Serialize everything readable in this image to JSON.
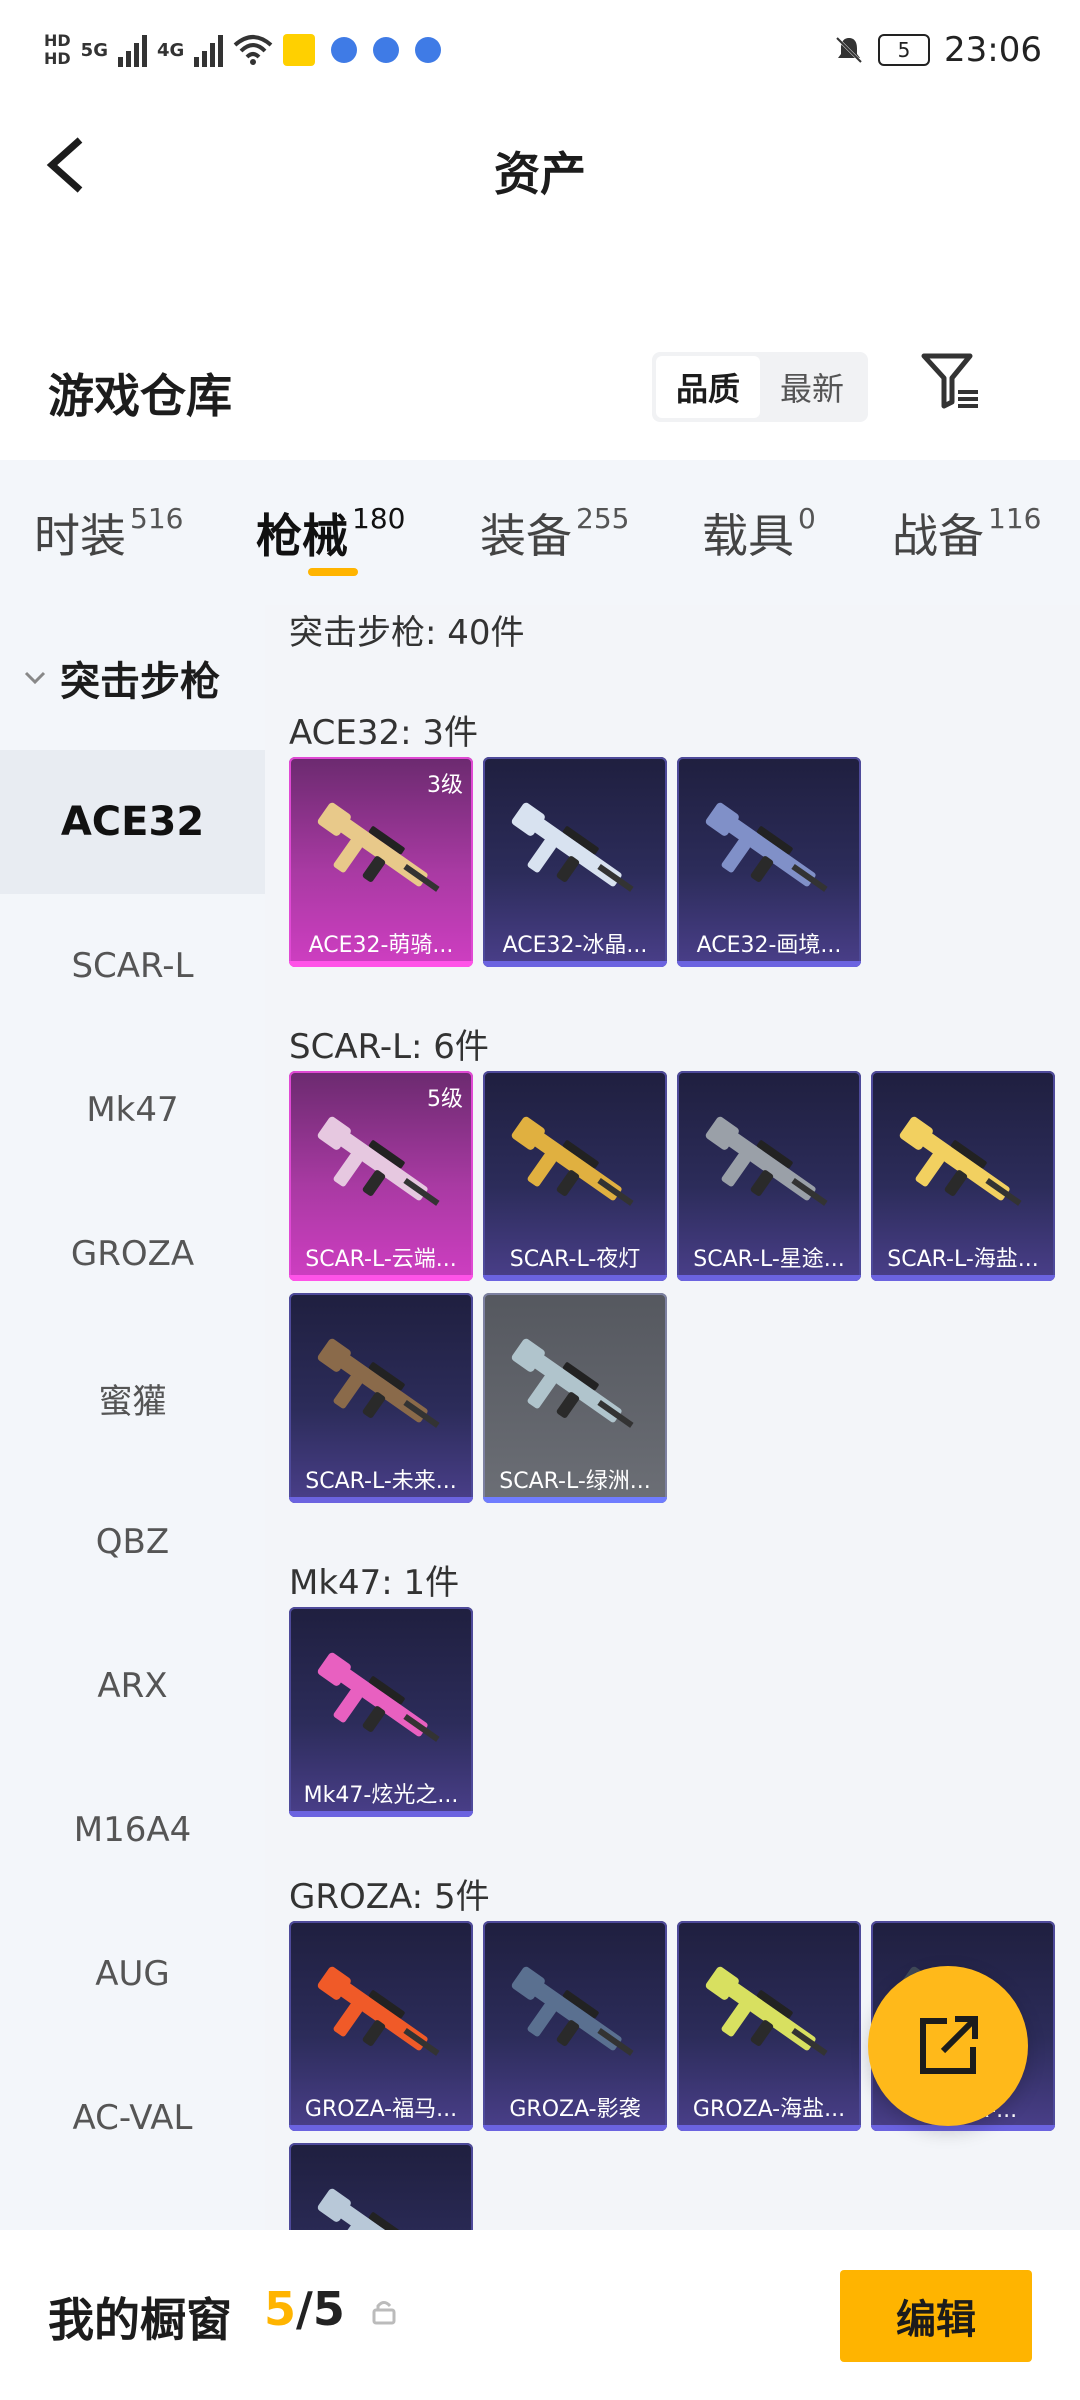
{
  "status_bar": {
    "left_labels": [
      "HD",
      "5G",
      "4G"
    ],
    "time": "23:06",
    "battery": "5"
  },
  "header": {
    "title": "资产"
  },
  "warehouse": {
    "title": "游戏仓库",
    "sort_options": [
      "品质",
      "最新"
    ],
    "active_sort": "品质"
  },
  "tabs": [
    {
      "label": "时装",
      "count": "516"
    },
    {
      "label": "枪械",
      "count": "180"
    },
    {
      "label": "装备",
      "count": "255"
    },
    {
      "label": "载具",
      "count": "0"
    },
    {
      "label": "战备",
      "count": "116"
    }
  ],
  "sidebar": {
    "header": "突击步枪",
    "items": [
      "ACE32",
      "SCAR-L",
      "Mk47",
      "GROZA",
      "蜜獾",
      "QBZ",
      "ARX",
      "M16A4",
      "AUG",
      "AC-VAL"
    ],
    "active": "ACE32"
  },
  "content": {
    "section_total": "突击步枪: 40件",
    "groups": [
      {
        "title": "ACE32: 3件",
        "items": [
          {
            "name": "ACE32-萌骑...",
            "level": "3级",
            "rarity": "pink"
          },
          {
            "name": "ACE32-冰晶...",
            "level": "",
            "rarity": "purple"
          },
          {
            "name": "ACE32-画境...",
            "level": "",
            "rarity": "purple"
          }
        ]
      },
      {
        "title": "SCAR-L: 6件",
        "items": [
          {
            "name": "SCAR-L-云端...",
            "level": "5级",
            "rarity": "pink"
          },
          {
            "name": "SCAR-L-夜灯",
            "level": "",
            "rarity": "purple"
          },
          {
            "name": "SCAR-L-星途...",
            "level": "",
            "rarity": "purple"
          },
          {
            "name": "SCAR-L-海盐...",
            "level": "",
            "rarity": "purple"
          },
          {
            "name": "SCAR-L-未来...",
            "level": "",
            "rarity": "purple"
          },
          {
            "name": "SCAR-L-绿洲...",
            "level": "",
            "rarity": "gray"
          }
        ]
      },
      {
        "title": "Mk47: 1件",
        "items": [
          {
            "name": "Mk47-炫光之...",
            "level": "",
            "rarity": "purple"
          }
        ]
      },
      {
        "title": "GROZA: 5件",
        "items": [
          {
            "name": "GROZA-福马...",
            "level": "",
            "rarity": "purple"
          },
          {
            "name": "GROZA-影袭",
            "level": "",
            "rarity": "purple"
          },
          {
            "name": "GROZA-海盐...",
            "level": "",
            "rarity": "purple"
          },
          {
            "name": "GROZA-...",
            "level": "",
            "rarity": "purple"
          },
          {
            "name": "",
            "level": "",
            "rarity": "purple"
          }
        ]
      }
    ]
  },
  "bottom_bar": {
    "title": "我的橱窗",
    "count_current": "5",
    "count_sep": "/",
    "count_total": "5",
    "edit_label": "编辑"
  },
  "colors": {
    "accent": "#ffb400",
    "pink_rarity": "#e049d4",
    "purple_rarity": "#6b63e0"
  }
}
